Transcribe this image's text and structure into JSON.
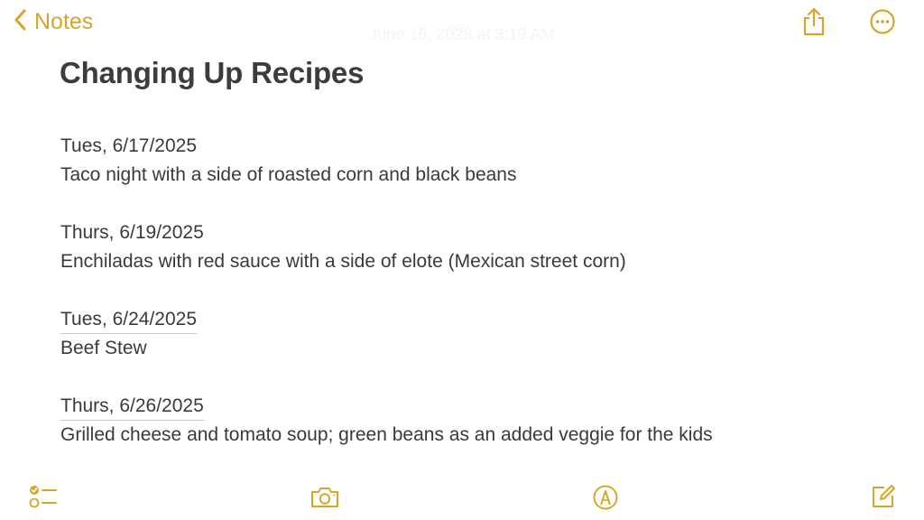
{
  "nav": {
    "back_label": "Notes",
    "back_icon": "chevron-left-icon"
  },
  "timestamp": "June 16, 2028 at 3:19 AM",
  "toolbar": {
    "share_icon": "share-icon",
    "more_icon": "ellipsis-circle-icon"
  },
  "note": {
    "title": "Changing Up Recipes",
    "entries": [
      {
        "date": "Tues, 6/17/2025",
        "text": "Taco night with a side of roasted corn and black beans"
      },
      {
        "date": "Thurs, 6/19/2025",
        "text": "Enchiladas with red sauce with a side of elote (Mexican street corn)"
      },
      {
        "date": "Tues, 6/24/2025",
        "text": "Beef Stew"
      },
      {
        "date": "Thurs, 6/26/2025",
        "text": "Grilled cheese and tomato soup; green beans as an added veggie for the kids"
      }
    ]
  },
  "bottom_toolbar": {
    "checklist_icon": "checklist-icon",
    "camera_icon": "camera-icon",
    "markup_icon": "markup-pen-icon",
    "compose_icon": "compose-icon"
  },
  "colors": {
    "accent": "#d4a72c",
    "text": "#3a3a3a"
  }
}
